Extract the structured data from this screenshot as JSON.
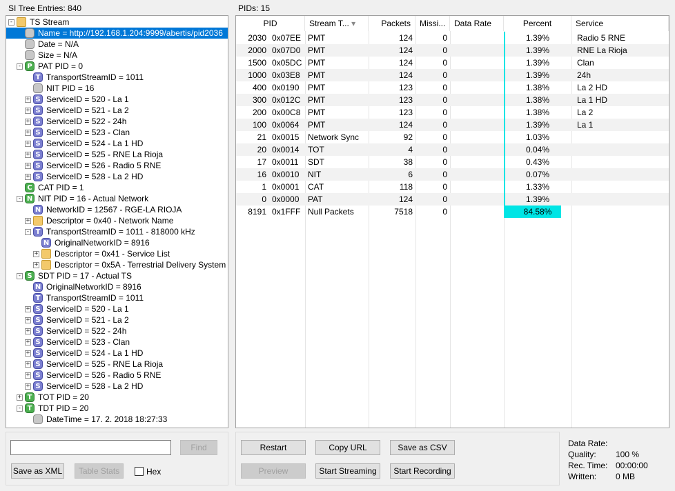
{
  "tree_header": "SI Tree Entries: 840",
  "pids_header": "PIDs: 15",
  "tree": [
    {
      "depth": 0,
      "tog": "-",
      "icon": "folder",
      "text": "TS Stream"
    },
    {
      "depth": 1,
      "tog": "",
      "icon": "gray",
      "text": "Name = http://192.168.1.204:9999/abertis/pid2036",
      "selected": true
    },
    {
      "depth": 1,
      "tog": "",
      "icon": "gray",
      "text": "Date = N/A"
    },
    {
      "depth": 1,
      "tog": "",
      "icon": "gray",
      "text": "Size = N/A"
    },
    {
      "depth": 1,
      "tog": "-",
      "icon": "P",
      "text": "PAT PID = 0"
    },
    {
      "depth": 2,
      "tog": "",
      "icon": "T",
      "text": "TransportStreamID = 1011"
    },
    {
      "depth": 2,
      "tog": "",
      "icon": "gray",
      "text": "NIT PID = 16"
    },
    {
      "depth": 2,
      "tog": "+",
      "icon": "S",
      "text": "ServiceID = 520 - La 1"
    },
    {
      "depth": 2,
      "tog": "+",
      "icon": "S",
      "text": "ServiceID = 521 - La 2"
    },
    {
      "depth": 2,
      "tog": "+",
      "icon": "S",
      "text": "ServiceID = 522 - 24h"
    },
    {
      "depth": 2,
      "tog": "+",
      "icon": "S",
      "text": "ServiceID = 523 - Clan"
    },
    {
      "depth": 2,
      "tog": "+",
      "icon": "S",
      "text": "ServiceID = 524 - La 1 HD"
    },
    {
      "depth": 2,
      "tog": "+",
      "icon": "S",
      "text": "ServiceID = 525 - RNE La Rioja"
    },
    {
      "depth": 2,
      "tog": "+",
      "icon": "S",
      "text": "ServiceID = 526 - Radio 5 RNE"
    },
    {
      "depth": 2,
      "tog": "+",
      "icon": "S",
      "text": "ServiceID = 528 - La 2 HD"
    },
    {
      "depth": 1,
      "tog": "",
      "icon": "C",
      "text": "CAT PID = 1"
    },
    {
      "depth": 1,
      "tog": "-",
      "icon": "P",
      "text": "NIT PID = 16 - Actual Network",
      "letter": "N"
    },
    {
      "depth": 2,
      "tog": "",
      "icon": "N",
      "text": "NetworkID = 12567 - RGE-LA RIOJA"
    },
    {
      "depth": 2,
      "tog": "+",
      "icon": "folder",
      "text": "Descriptor = 0x40 - Network Name"
    },
    {
      "depth": 2,
      "tog": "-",
      "icon": "T",
      "text": "TransportStreamID = 1011 - 818000 kHz"
    },
    {
      "depth": 3,
      "tog": "",
      "icon": "N",
      "text": "OriginalNetworkID = 8916"
    },
    {
      "depth": 3,
      "tog": "+",
      "icon": "folder",
      "text": "Descriptor = 0x41 - Service List"
    },
    {
      "depth": 3,
      "tog": "+",
      "icon": "folder",
      "text": "Descriptor = 0x5A - Terrestrial Delivery System"
    },
    {
      "depth": 1,
      "tog": "-",
      "icon": "P",
      "text": "SDT PID = 17 - Actual TS",
      "letter": "S"
    },
    {
      "depth": 2,
      "tog": "",
      "icon": "N",
      "text": "OriginalNetworkID = 8916"
    },
    {
      "depth": 2,
      "tog": "",
      "icon": "T",
      "text": "TransportStreamID = 1011"
    },
    {
      "depth": 2,
      "tog": "+",
      "icon": "S",
      "text": "ServiceID = 520 - La 1"
    },
    {
      "depth": 2,
      "tog": "+",
      "icon": "S",
      "text": "ServiceID = 521 - La 2"
    },
    {
      "depth": 2,
      "tog": "+",
      "icon": "S",
      "text": "ServiceID = 522 - 24h"
    },
    {
      "depth": 2,
      "tog": "+",
      "icon": "S",
      "text": "ServiceID = 523 - Clan"
    },
    {
      "depth": 2,
      "tog": "+",
      "icon": "S",
      "text": "ServiceID = 524 - La 1 HD"
    },
    {
      "depth": 2,
      "tog": "+",
      "icon": "S",
      "text": "ServiceID = 525 - RNE La Rioja"
    },
    {
      "depth": 2,
      "tog": "+",
      "icon": "S",
      "text": "ServiceID = 526 - Radio 5 RNE"
    },
    {
      "depth": 2,
      "tog": "+",
      "icon": "S",
      "text": "ServiceID = 528 - La 2 HD"
    },
    {
      "depth": 1,
      "tog": "+",
      "icon": "P",
      "text": "TOT PID = 20",
      "letter": "T"
    },
    {
      "depth": 1,
      "tog": "-",
      "icon": "P",
      "text": "TDT PID = 20",
      "letter": "T"
    },
    {
      "depth": 2,
      "tog": "",
      "icon": "gray",
      "text": "DateTime = 17. 2. 2018 18:27:33"
    }
  ],
  "table": {
    "columns": [
      "PID",
      "",
      "Stream T...",
      "Packets",
      "Missi...",
      "Data Rate",
      "Percent",
      "Service"
    ],
    "rows": [
      {
        "pid": "2030",
        "hex": "0x07EE",
        "type": "PMT",
        "packets": "124",
        "missing": "0",
        "rate": "",
        "percent": "1.39%",
        "pct": 1.39,
        "service": "Radio 5 RNE"
      },
      {
        "pid": "2000",
        "hex": "0x07D0",
        "type": "PMT",
        "packets": "124",
        "missing": "0",
        "rate": "",
        "percent": "1.39%",
        "pct": 1.39,
        "service": "RNE La Rioja"
      },
      {
        "pid": "1500",
        "hex": "0x05DC",
        "type": "PMT",
        "packets": "124",
        "missing": "0",
        "rate": "",
        "percent": "1.39%",
        "pct": 1.39,
        "service": "Clan"
      },
      {
        "pid": "1000",
        "hex": "0x03E8",
        "type": "PMT",
        "packets": "124",
        "missing": "0",
        "rate": "",
        "percent": "1.39%",
        "pct": 1.39,
        "service": "24h"
      },
      {
        "pid": "400",
        "hex": "0x0190",
        "type": "PMT",
        "packets": "123",
        "missing": "0",
        "rate": "",
        "percent": "1.38%",
        "pct": 1.38,
        "service": "La 2 HD"
      },
      {
        "pid": "300",
        "hex": "0x012C",
        "type": "PMT",
        "packets": "123",
        "missing": "0",
        "rate": "",
        "percent": "1.38%",
        "pct": 1.38,
        "service": "La 1 HD"
      },
      {
        "pid": "200",
        "hex": "0x00C8",
        "type": "PMT",
        "packets": "123",
        "missing": "0",
        "rate": "",
        "percent": "1.38%",
        "pct": 1.38,
        "service": "La 2"
      },
      {
        "pid": "100",
        "hex": "0x0064",
        "type": "PMT",
        "packets": "124",
        "missing": "0",
        "rate": "",
        "percent": "1.39%",
        "pct": 1.39,
        "service": "La 1"
      },
      {
        "pid": "21",
        "hex": "0x0015",
        "type": "Network Sync",
        "packets": "92",
        "missing": "0",
        "rate": "",
        "percent": "1.03%",
        "pct": 1.03,
        "service": ""
      },
      {
        "pid": "20",
        "hex": "0x0014",
        "type": "TOT",
        "packets": "4",
        "missing": "0",
        "rate": "",
        "percent": "0.04%",
        "pct": 0.04,
        "service": ""
      },
      {
        "pid": "17",
        "hex": "0x0011",
        "type": "SDT",
        "packets": "38",
        "missing": "0",
        "rate": "",
        "percent": "0.43%",
        "pct": 0.43,
        "service": ""
      },
      {
        "pid": "16",
        "hex": "0x0010",
        "type": "NIT",
        "packets": "6",
        "missing": "0",
        "rate": "",
        "percent": "0.07%",
        "pct": 0.07,
        "service": ""
      },
      {
        "pid": "1",
        "hex": "0x0001",
        "type": "CAT",
        "packets": "118",
        "missing": "0",
        "rate": "",
        "percent": "1.33%",
        "pct": 1.33,
        "service": ""
      },
      {
        "pid": "0",
        "hex": "0x0000",
        "type": "PAT",
        "packets": "124",
        "missing": "0",
        "rate": "",
        "percent": "1.39%",
        "pct": 1.39,
        "service": ""
      },
      {
        "pid": "8191",
        "hex": "0x1FFF",
        "type": "Null Packets",
        "packets": "7518",
        "missing": "0",
        "rate": "",
        "percent": "84.58%",
        "pct": 84.58,
        "service": ""
      }
    ]
  },
  "controls": {
    "search_value": "",
    "find_label": "Find",
    "save_xml_label": "Save as XML",
    "table_stats_label": "Table Stats",
    "hex_label": "Hex",
    "restart_label": "Restart",
    "copy_url_label": "Copy URL",
    "save_csv_label": "Save as CSV",
    "preview_label": "Preview",
    "start_streaming_label": "Start Streaming",
    "start_recording_label": "Start Recording"
  },
  "stats": {
    "data_rate_label": "Data Rate:",
    "data_rate_value": "",
    "quality_label": "Quality:",
    "quality_value": "100 %",
    "rec_time_label": "Rec. Time:",
    "rec_time_value": "00:00:00",
    "written_label": "Written:",
    "written_value": "0 MB"
  },
  "colors": {
    "selection": "#0078d7",
    "percent_bar": "#00e5e5"
  }
}
